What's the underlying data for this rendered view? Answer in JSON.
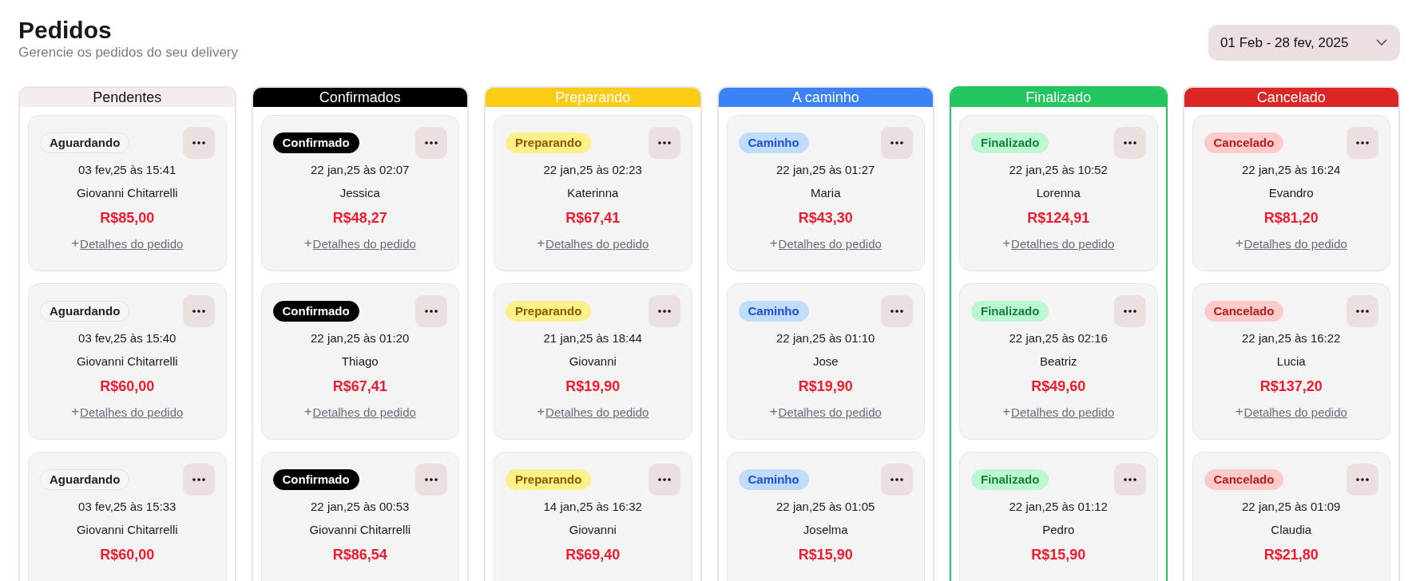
{
  "header": {
    "title": "Pedidos",
    "subtitle": "Gerencie os pedidos do seu delivery"
  },
  "date_range": {
    "value": "01 Feb - 28 fev, 2025"
  },
  "columns": [
    {
      "title": "Pendentes",
      "kind": "pending",
      "color": "#f5ecf3",
      "selected": false,
      "cards": [
        {
          "status": "Aguardando",
          "date": "03 fev,25 às 15:41",
          "customer": "Giovanni Chitarrelli",
          "price": "R$85,00",
          "link": "Detalhes do pedido",
          "link_icon": "+"
        },
        {
          "status": "Aguardando",
          "date": "03 fev,25 às 15:40",
          "customer": "Giovanni Chitarrelli",
          "price": "R$60,00",
          "link": "Detalhes do pedido",
          "link_icon": "+"
        },
        {
          "status": "Aguardando",
          "date": "03 fev,25 às 15:33",
          "customer": "Giovanni Chitarrelli",
          "price": "R$60,00"
        }
      ]
    },
    {
      "title": "Confirmados",
      "kind": "confirmed",
      "color": "#000000",
      "selected": false,
      "cards": [
        {
          "status": "Confirmado",
          "date": "22 jan,25 às 02:07",
          "customer": "Jessica",
          "price": "R$48,27",
          "link": "Detalhes do pedido",
          "link_icon": "+"
        },
        {
          "status": "Confirmado",
          "date": "22 jan,25 às 01:20",
          "customer": "Thiago",
          "price": "R$67,41",
          "link": "Detalhes do pedido",
          "link_icon": "+"
        },
        {
          "status": "Confirmado",
          "date": "22 jan,25 às 00:53",
          "customer": "Giovanni Chitarrelli",
          "price": "R$86,54"
        }
      ]
    },
    {
      "title": "Preparando",
      "kind": "preparing",
      "color": "#facc15",
      "selected": false,
      "cards": [
        {
          "status": "Preparando",
          "date": "22 jan,25 às 02:23",
          "customer": "Katerinna",
          "price": "R$67,41",
          "link": "Detalhes do pedido",
          "link_icon": "+"
        },
        {
          "status": "Preparando",
          "date": "21 jan,25 às 18:44",
          "customer": "Giovanni",
          "price": "R$19,90",
          "link": "Detalhes do pedido",
          "link_icon": "+"
        },
        {
          "status": "Preparando",
          "date": "14 jan,25 às 16:32",
          "customer": "Giovanni",
          "price": "R$69,40"
        }
      ]
    },
    {
      "title": "A caminho",
      "kind": "on_the_way",
      "color": "#3b82f6",
      "selected": false,
      "cards": [
        {
          "status": "Caminho",
          "date": "22 jan,25 às 01:27",
          "customer": "Maria",
          "price": "R$43,30",
          "link": "Detalhes do pedido",
          "link_icon": "+"
        },
        {
          "status": "Caminho",
          "date": "22 jan,25 às 01:10",
          "customer": "Jose",
          "price": "R$19,90",
          "link": "Detalhes do pedido",
          "link_icon": "+"
        },
        {
          "status": "Caminho",
          "date": "22 jan,25 às 01:05",
          "customer": "Joselma",
          "price": "R$15,90"
        }
      ]
    },
    {
      "title": "Finalizado",
      "kind": "done",
      "color": "#22c55e",
      "selected": true,
      "cards": [
        {
          "status": "Finalizado",
          "date": "22 jan,25 às 10:52",
          "customer": "Lorenna",
          "price": "R$124,91",
          "link": "Detalhes do pedido",
          "link_icon": "+"
        },
        {
          "status": "Finalizado",
          "date": "22 jan,25 às 02:16",
          "customer": "Beatriz",
          "price": "R$49,60",
          "link": "Detalhes do pedido",
          "link_icon": "+"
        },
        {
          "status": "Finalizado",
          "date": "22 jan,25 às 01:12",
          "customer": "Pedro",
          "price": "R$15,90"
        }
      ]
    },
    {
      "title": "Cancelado",
      "kind": "cancelled",
      "color": "#dc2626",
      "selected": false,
      "cards": [
        {
          "status": "Cancelado",
          "date": "22 jan,25 às 16:24",
          "customer": "Evandro",
          "price": "R$81,20",
          "link": "Detalhes do pedido",
          "link_icon": "+"
        },
        {
          "status": "Cancelado",
          "date": "22 jan,25 às 16:22",
          "customer": "Lucia",
          "price": "R$137,20",
          "link": "Detalhes do pedido",
          "link_icon": "+"
        },
        {
          "status": "Cancelado",
          "date": "22 jan,25 às 01:09",
          "customer": "Claudia",
          "price": "R$21,80"
        }
      ]
    }
  ]
}
